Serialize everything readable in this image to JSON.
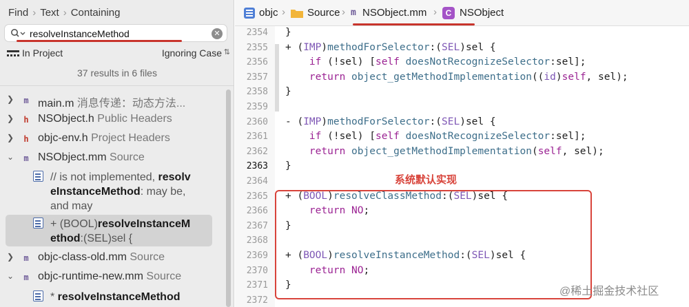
{
  "navigator": {
    "breadcrumb": [
      "Find",
      "Text",
      "Containing"
    ],
    "search": {
      "value": "resolveInstanceMethod"
    },
    "scope": "In Project",
    "case_mode": "Ignoring Case",
    "results_summary": "37 results in 6 files",
    "results": [
      {
        "type": "file",
        "icon": "m",
        "name": "main.m",
        "desc": "消息传递：动态方法...",
        "expanded": false
      },
      {
        "type": "file",
        "icon": "h",
        "name": "NSObject.h",
        "desc": "Public Headers",
        "expanded": false
      },
      {
        "type": "file",
        "icon": "h",
        "name": "objc-env.h",
        "desc": "Project Headers",
        "expanded": false
      },
      {
        "type": "file",
        "icon": "m",
        "name": "NSObject.mm",
        "desc": "Source",
        "expanded": true
      },
      {
        "type": "match",
        "line1_pre": "// is not implemented, ",
        "line1_bold": "resolv",
        "line2_bold": "eInstanceMethod",
        "line2_post": ": may be,",
        "line3": "and may"
      },
      {
        "type": "match",
        "line1_pre": "+ (BOOL)",
        "line1_bold": "resolveInstanceM",
        "line2_bold": "ethod",
        "line2_post": ":(SEL)sel {",
        "selected": true
      },
      {
        "type": "file",
        "icon": "m",
        "name": "objc-class-old.mm",
        "desc": "Source",
        "expanded": false
      },
      {
        "type": "file",
        "icon": "m",
        "name": "objc-runtime-new.mm",
        "desc": "Source",
        "expanded": true
      },
      {
        "type": "match",
        "line1_pre": "* ",
        "line1_bold": "resolveInstanceMethod"
      }
    ]
  },
  "jump_bar": {
    "crumbs": [
      {
        "icon": "project-icon",
        "label": "objc"
      },
      {
        "icon": "folder-icon",
        "label": "Source"
      },
      {
        "icon": "m-file-icon",
        "label": "NSObject.mm"
      },
      {
        "icon": "class-icon",
        "label": "NSObject",
        "badge": "C"
      }
    ]
  },
  "editor": {
    "current_line": "2363",
    "lines": [
      {
        "n": "2354",
        "code": "}"
      },
      {
        "n": "2355",
        "code": "+ (IMP)methodForSelector:(SEL)sel {"
      },
      {
        "n": "2356",
        "code": "    if (!sel) [self doesNotRecognizeSelector:sel];"
      },
      {
        "n": "2357",
        "code": "    return object_getMethodImplementation((id)self, sel);"
      },
      {
        "n": "2358",
        "code": "}"
      },
      {
        "n": "2359",
        "code": ""
      },
      {
        "n": "2360",
        "code": "- (IMP)methodForSelector:(SEL)sel {"
      },
      {
        "n": "2361",
        "code": "    if (!sel) [self doesNotRecognizeSelector:sel];"
      },
      {
        "n": "2362",
        "code": "    return object_getMethodImplementation(self, sel);"
      },
      {
        "n": "2363",
        "code": "}"
      },
      {
        "n": "2364",
        "code": ""
      },
      {
        "n": "2365",
        "code": "+ (BOOL)resolveClassMethod:(SEL)sel {"
      },
      {
        "n": "2366",
        "code": "    return NO;"
      },
      {
        "n": "2367",
        "code": "}"
      },
      {
        "n": "2368",
        "code": ""
      },
      {
        "n": "2369",
        "code": "+ (BOOL)resolveInstanceMethod:(SEL)sel {"
      },
      {
        "n": "2370",
        "code": "    return NO;"
      },
      {
        "n": "2371",
        "code": "}"
      },
      {
        "n": "2372",
        "code": ""
      }
    ],
    "annotation": "系统默认实现",
    "watermark": "@稀土掘金技术社区"
  },
  "colors": {
    "highlight_red": "#d8433a",
    "keyword": "#9b2393",
    "type": "#7e57b5",
    "method": "#3d6e8a"
  }
}
